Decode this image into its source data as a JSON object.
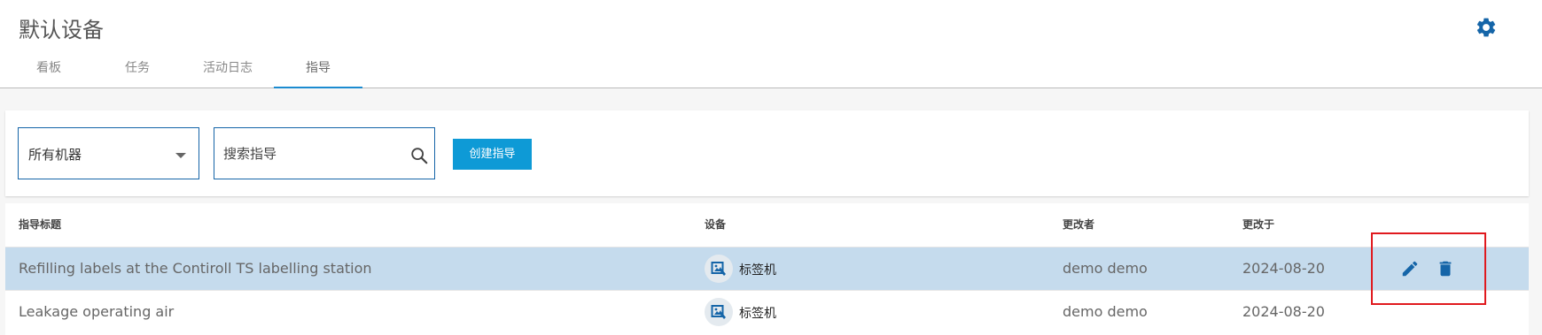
{
  "header": {
    "title": "默认设备",
    "tabs": [
      {
        "label": "看板"
      },
      {
        "label": "任务"
      },
      {
        "label": "活动日志"
      },
      {
        "label": "指导",
        "active": true
      }
    ]
  },
  "toolbar": {
    "machine_filter": "所有机器",
    "search_placeholder": "搜索指导",
    "create_button": "创建指导"
  },
  "table": {
    "columns": [
      "指导标题",
      "设备",
      "更改者",
      "更改于"
    ],
    "rows": [
      {
        "title": "Refilling labels at the Contiroll TS labelling station",
        "device": "标签机",
        "changed_by": "demo demo",
        "changed_at": "2024-08-20",
        "selected": true
      },
      {
        "title": "Leakage operating air",
        "device": "标签机",
        "changed_by": "demo demo",
        "changed_at": "2024-08-20",
        "selected": false
      }
    ],
    "row_actions": [
      "edit-icon",
      "delete-icon"
    ]
  },
  "colors": {
    "accent": "#1b8bd0",
    "button": "#0e9ad6",
    "selected_row": "#c5dbed",
    "icon_blue": "#1565a8",
    "highlight": "#e0191e"
  }
}
